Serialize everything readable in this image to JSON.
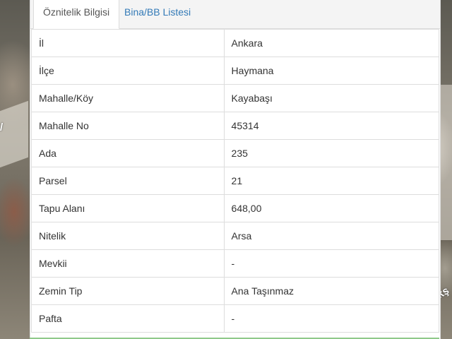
{
  "tabs": [
    {
      "label": "Öznitelik Bilgisi",
      "active": true
    },
    {
      "label": "Bina/BB Listesi",
      "active": false
    }
  ],
  "rows": [
    {
      "key": "İl",
      "value": "Ankara"
    },
    {
      "key": "İlçe",
      "value": "Haymana"
    },
    {
      "key": "Mahalle/Köy",
      "value": "Kayabaşı"
    },
    {
      "key": "Mahalle No",
      "value": "45314"
    },
    {
      "key": "Ada",
      "value": "235"
    },
    {
      "key": "Parsel",
      "value": "21"
    },
    {
      "key": "Tapu Alanı",
      "value": "648,00"
    },
    {
      "key": "Nitelik",
      "value": "Arsa"
    },
    {
      "key": "Mevkii",
      "value": "-"
    },
    {
      "key": "Zemin Tip",
      "value": "Ana Taşınmaz"
    },
    {
      "key": "Pafta",
      "value": "-"
    }
  ],
  "map": {
    "label_right": "kş",
    "label_left": "/"
  },
  "colors": {
    "tab_link": "#337ab7",
    "text": "#333333",
    "border": "#dddddd"
  }
}
